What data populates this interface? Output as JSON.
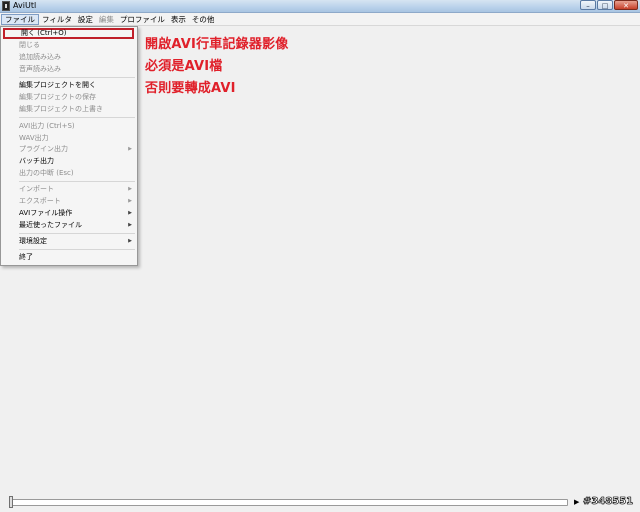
{
  "window": {
    "title": "AviUtl",
    "buttons": {
      "minimize": "–",
      "maximize": "□",
      "close": "✕"
    }
  },
  "menubar": {
    "items": [
      "ファイル",
      "フィルタ",
      "設定",
      "編集",
      "プロファイル",
      "表示",
      "その他"
    ]
  },
  "file_menu": {
    "items": [
      {
        "label": "開く (Ctrl+O)",
        "disabled": false
      },
      {
        "label": "閉じる",
        "disabled": true
      },
      {
        "label": "追加読み込み",
        "disabled": true
      },
      {
        "label": "音声読み込み",
        "disabled": true
      },
      {
        "label": "編集プロジェクトを開く",
        "disabled": false
      },
      {
        "label": "編集プロジェクトの保存",
        "disabled": true
      },
      {
        "label": "編集プロジェクトの上書き",
        "disabled": true
      },
      {
        "label": "AVI出力 (Ctrl+S)",
        "disabled": true
      },
      {
        "label": "WAV出力",
        "disabled": true
      },
      {
        "label": "プラグイン出力",
        "disabled": true,
        "submenu": true
      },
      {
        "label": "バッチ出力",
        "disabled": false
      },
      {
        "label": "出力の中断 (Esc)",
        "disabled": true
      },
      {
        "label": "インポート",
        "disabled": true,
        "submenu": true
      },
      {
        "label": "エクスポート",
        "disabled": true,
        "submenu": true
      },
      {
        "label": "AVIファイル操作",
        "disabled": false,
        "submenu": true
      },
      {
        "label": "最近使ったファイル",
        "disabled": false,
        "submenu": true
      },
      {
        "label": "環境設定",
        "disabled": false,
        "submenu": true
      },
      {
        "label": "終了",
        "disabled": false
      }
    ],
    "submenu_arrow": "▶"
  },
  "annotation": {
    "lines": [
      "開啟AVI行車記錄器影像",
      "必須是AVI檔",
      "否則要轉成AVI"
    ],
    "color": "#e0202a"
  },
  "statusbar": {
    "play_symbol": "▶",
    "frame_counter": "#348551"
  }
}
